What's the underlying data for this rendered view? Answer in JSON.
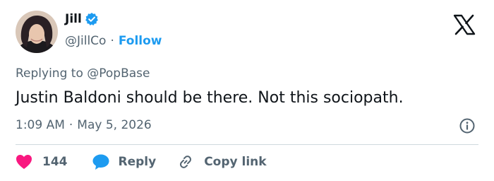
{
  "author": {
    "name": "Jill",
    "handle": "@JillCo",
    "separator": "·",
    "follow_label": "Follow",
    "verified": true
  },
  "logo_icon": "x-logo-icon",
  "replying": {
    "prefix": "Replying to",
    "target": "@PopBase"
  },
  "tweet": {
    "text": "Justin Baldoni should be there. Not this sociopath.",
    "time": "1:09 AM",
    "separator": "·",
    "date": "May 5, 2026"
  },
  "actions": {
    "like_count": "144",
    "reply_label": "Reply",
    "copy_label": "Copy link"
  },
  "colors": {
    "accent": "#1d9bf0",
    "like": "#f91880",
    "text": "#0f1419",
    "secondary": "#536471",
    "divider": "#cfd9de"
  }
}
